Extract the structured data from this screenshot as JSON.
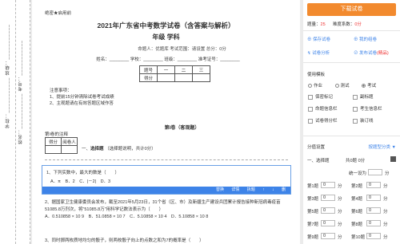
{
  "binding": {
    "col1": "学校：___________ 班级：___________",
    "col2": "姓名：___________ 考号：___________"
  },
  "paper": {
    "secret": "绝密★启用前",
    "title": "2021年广东省中考数学试卷（含答案与解析）",
    "subtitle": "年级 学科",
    "meta": "命题人：优题库 考试范围：请设置 总分：0分",
    "student": "姓名：________ 学校：________ 班级：________ 准考证号：________",
    "score_table": {
      "row_label": "题号",
      "cols": [
        "一",
        "二",
        "三"
      ],
      "score_label": "得分"
    },
    "notice_title": "注意事项：",
    "notice_1": "1、提前15分钟清除试卷考试成绩",
    "notice_2": "2、主观题请在有效答题区域作答",
    "part1": "第I卷（客观题）",
    "note": "第I卷的注释",
    "mini_table": {
      "a": "得分",
      "b": "阅卷人"
    },
    "section_prefix": "一、",
    "section_name": "选择题",
    "section_desc": "（选择题说明，共计0分）",
    "q1_text": "1、下列实数中，最大的数是（　　）",
    "q1_opts": "A．π　B．2　C．|－2|　D．3",
    "q1_bar": [
      "替换",
      "详情",
      "拆题",
      "↑",
      "↓",
      "删"
    ],
    "q2_line1": "2、据国家卫生健康委员会发布，截至2021年5月23日，31个省（区、市）及新疆生产建设兵团累计报告接种新冠病毒疫苗51085.8万剂次，将\"51085.8万\"用科学记数法表示为（　　）",
    "q2_opts": "A．0.510858 × 10 9　B．51.0858 × 10 7　C．5.10858 × 10 4　D．5.10858 × 10 8",
    "q3": "3、同时掷两枚质地均匀的骰子，则两枚骰子向上的点数之和为7的概率是（　　）"
  },
  "panel": {
    "download": "下载试卷",
    "views_label": "题量：",
    "views_value": "25",
    "score_label": "难度系数：",
    "score_value": "0分",
    "act1": "保存试卷",
    "act2": "我的组卷",
    "act3": "试卷分析",
    "act4": "发布试卷",
    "act4_tag": "(精品)",
    "template_title": "使用模板",
    "radio": [
      "作业",
      "测试",
      "考试"
    ],
    "checks": [
      "保密标记",
      "副标题",
      "命题信息栏",
      "考生信息栏",
      "试卷得分栏",
      "装订线"
    ],
    "score_setting_title": "分值设置",
    "score_link": "按题型分类 ▼",
    "type_label": "一、选择题",
    "type_total": "共0题 0分",
    "every": "统一设为",
    "every_unit": "分",
    "q_rows": [
      {
        "a": "第1题",
        "b": "0",
        "u": "分",
        "c": "第2题",
        "d": "0",
        "e": "分"
      },
      {
        "a": "第3题",
        "b": "0",
        "u": "分",
        "c": "第4题",
        "d": "0",
        "e": "分"
      },
      {
        "a": "第5题",
        "b": "0",
        "u": "分",
        "c": "第6题",
        "d": "0",
        "e": "分"
      },
      {
        "a": "第7题",
        "b": "0",
        "u": "分",
        "c": "第8题",
        "d": "0",
        "e": "分"
      },
      {
        "a": "第9题",
        "b": "0",
        "u": "分",
        "c": "第10题",
        "d": "0",
        "e": "分"
      }
    ]
  }
}
